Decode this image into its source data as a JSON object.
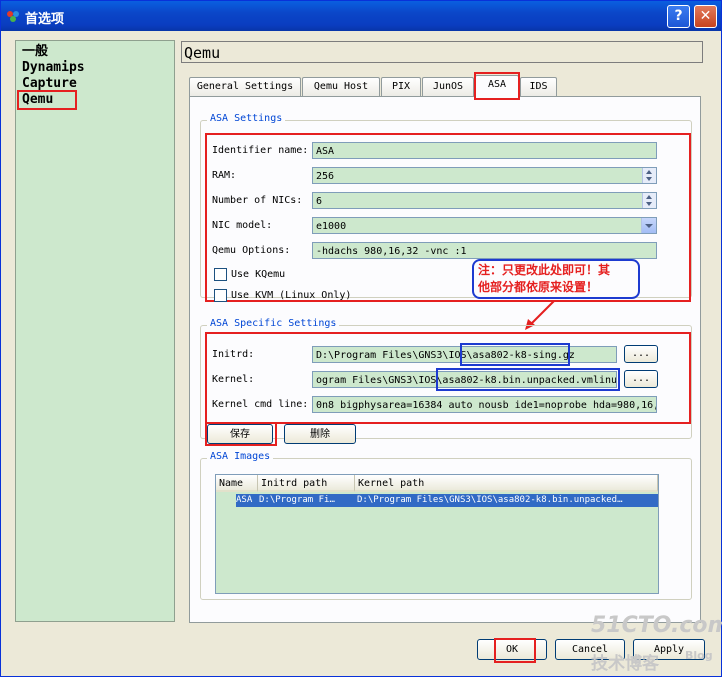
{
  "window": {
    "title": "首选项",
    "help": "?",
    "close": "✕"
  },
  "nav": {
    "items": [
      "一般",
      "Dynamips",
      "Capture",
      "Qemu"
    ]
  },
  "heading": "Qemu",
  "tabs": [
    "General Settings",
    "Qemu Host",
    "PIX",
    "JunOS",
    "ASA",
    "IDS"
  ],
  "asa_settings": {
    "title": "ASA Settings",
    "identifier_label": "Identifier name:",
    "identifier_value": "ASA",
    "ram_label": "RAM:",
    "ram_value": "256",
    "nics_label": "Number of NICs:",
    "nics_value": "6",
    "nic_model_label": "NIC model:",
    "nic_model_value": "e1000",
    "qemu_options_label": "Qemu Options:",
    "qemu_options_value": "-hdachs 980,16,32 -vnc :1",
    "use_kqemu": "Use KQemu",
    "use_kvm": "Use KVM (Linux Only)"
  },
  "callout": {
    "line1": "注：只更改此处即可！其",
    "line2": "他部分都依原来设置！"
  },
  "asa_specific": {
    "title": "ASA Specific Settings",
    "initrd_label": "Initrd:",
    "initrd_value": "D:\\Program Files\\GNS3\\IOS\\asa802-k8-sing.gz",
    "kernel_label": "Kernel:",
    "kernel_value": "ogram Files\\GNS3\\IOS\\asa802-k8.bin.unpacked.vmlinuz",
    "cmdline_label": "Kernel cmd line:",
    "cmdline_value": "0n8 bigphysarea=16384 auto nousb ide1=noprobe hda=980,16,32",
    "browse": "..."
  },
  "buttons": {
    "save": "保存",
    "delete": "删除",
    "ok": "OK",
    "cancel": "Cancel",
    "apply": "Apply"
  },
  "asa_images": {
    "title": "ASA Images",
    "columns": [
      "Name",
      "Initrd path",
      "Kernel path"
    ],
    "rows": [
      {
        "name": "ASA",
        "initrd": "D:\\Program Fi…",
        "kernel": "D:\\Program Files\\GNS3\\IOS\\asa802-k8.bin.unpacked…"
      }
    ]
  },
  "watermark": {
    "line1": "51CTO.com",
    "line2": "技术博客",
    "line3": "Blog"
  }
}
